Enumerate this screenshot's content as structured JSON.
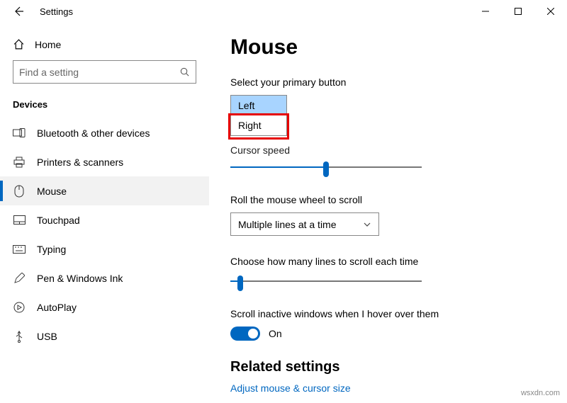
{
  "window": {
    "title": "Settings"
  },
  "sidebar": {
    "home": "Home",
    "search_placeholder": "Find a setting",
    "section": "Devices",
    "items": [
      {
        "label": "Bluetooth & other devices"
      },
      {
        "label": "Printers & scanners"
      },
      {
        "label": "Mouse"
      },
      {
        "label": "Touchpad"
      },
      {
        "label": "Typing"
      },
      {
        "label": "Pen & Windows Ink"
      },
      {
        "label": "AutoPlay"
      },
      {
        "label": "USB"
      }
    ]
  },
  "main": {
    "heading": "Mouse",
    "primary_button_label": "Select your primary button",
    "primary_options": {
      "opt0": "Left",
      "opt1": "Right"
    },
    "cursor_speed_label": "Cursor speed",
    "cursor_speed_value": 50,
    "scroll_wheel_label": "Roll the mouse wheel to scroll",
    "scroll_wheel_value": "Multiple lines at a time",
    "lines_label": "Choose how many lines to scroll each time",
    "lines_value": 5,
    "inactive_label": "Scroll inactive windows when I hover over them",
    "inactive_state": "On",
    "related_heading": "Related settings",
    "related_link": "Adjust mouse & cursor size"
  },
  "watermark": "wsxdn.com"
}
